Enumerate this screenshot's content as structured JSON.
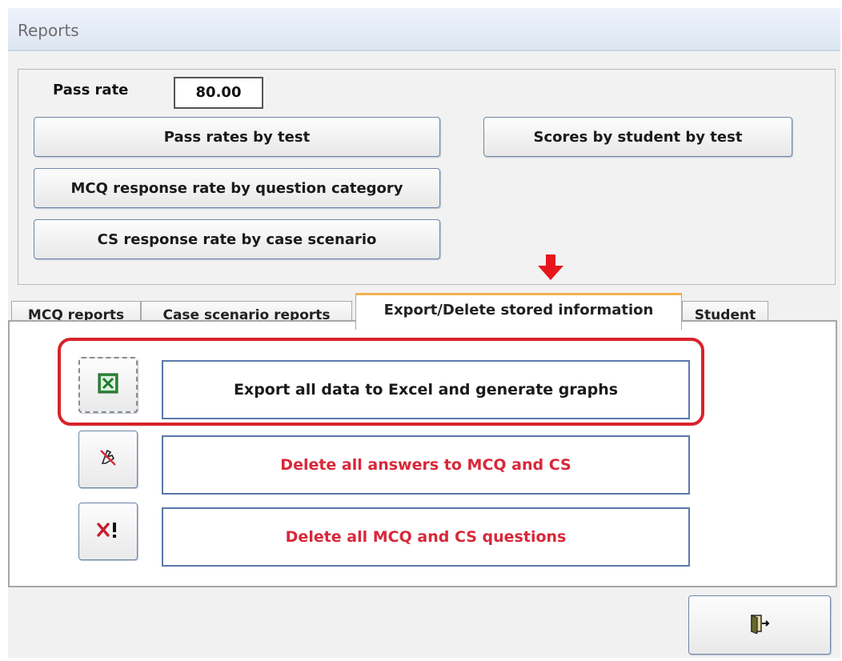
{
  "window": {
    "title": "Reports"
  },
  "header": {
    "pass_rate_label": "Pass rate",
    "pass_rate_value": "80.00",
    "buttons": {
      "pass_rates_by_test": "Pass rates by test",
      "scores_by_student_by_test": "Scores by student by test",
      "mcq_response_rate": "MCQ response rate by question category",
      "cs_response_rate": "CS response rate by case scenario"
    }
  },
  "tabs": [
    {
      "label": "MCQ reports",
      "active": false
    },
    {
      "label": "Case scenario reports",
      "active": false
    },
    {
      "label": "Export/Delete stored information",
      "active": true
    },
    {
      "label": "Student",
      "active": false
    }
  ],
  "panel": {
    "export_label": "Export all data to Excel and generate graphs",
    "delete_answers_label": "Delete all answers to MCQ and CS",
    "delete_questions_label": "Delete all MCQ and CS questions",
    "icons": {
      "export": "excel-icon",
      "delete_answers": "erase-icon",
      "delete_questions": "delete-x-icon",
      "exit": "exit-door-icon"
    }
  },
  "colors": {
    "danger_text": "#d8283a",
    "highlight": "#d8232a",
    "active_tab_accent": "#f2b14f",
    "button_border": "#5a78a8"
  }
}
